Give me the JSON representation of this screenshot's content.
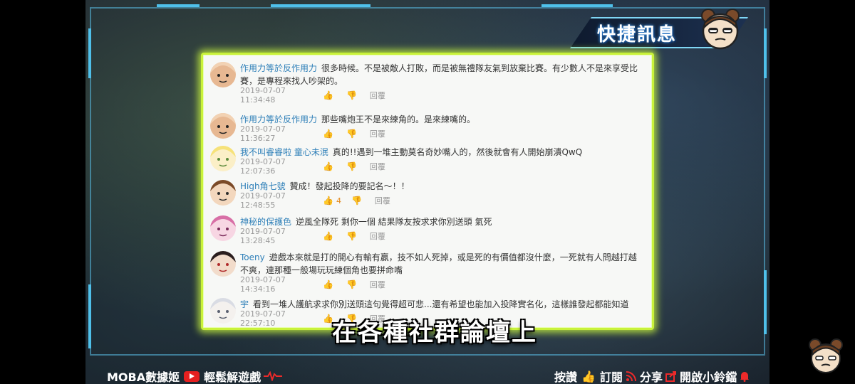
{
  "header": {
    "title": "快捷訊息"
  },
  "comments": [
    {
      "user": "作用力等於反作用力",
      "text": "很多時候。不是被敵人打敗，而是被無禮隊友氣到放棄比賽。有少數人不是來享受比賽，是專程來找人吵架的。",
      "timestamp": "2019-07-07 11:34:48",
      "likes": "",
      "reply_label": "回覆",
      "avatar": "bald-man-avatar"
    },
    {
      "user": "作用力等於反作用力",
      "text": "那些嘴炮王不是來練角的。是來練嘴的。",
      "timestamp": "2019-07-07 11:36:27",
      "likes": "",
      "reply_label": "回覆",
      "avatar": "bald-man-avatar"
    },
    {
      "user": "我不叫睿睿啦  童心未泯",
      "text": "真的!!遇到一堆主動莫名奇妙嘴人的，然後就會有人開始崩潰QwQ",
      "timestamp": "2019-07-07 12:07:36",
      "likes": "",
      "reply_label": "回覆",
      "avatar": "blonde-anime-avatar"
    },
    {
      "user": "High角七號",
      "text": "贊成！發起投降的要記名～！！",
      "timestamp": "2019-07-07 12:48:55",
      "likes": "4",
      "reply_label": "回覆",
      "avatar": "brown-hair-anime-avatar"
    },
    {
      "user": "神秘的保護色",
      "text": "逆風全隊死 剩你一個 結果隊友按求求你別送頭 氣死",
      "timestamp": "2019-07-07 13:28:45",
      "likes": "",
      "reply_label": "回覆",
      "avatar": "pink-hair-anime-avatar"
    },
    {
      "user": "Toeny",
      "text": "遊戲本來就是打的開心有輸有贏，技不如人死掉，或是死的有價值都沒什麼，一死就有人問越打越不爽，連那種一般場玩玩練個角也要拼命嘴",
      "timestamp": "2019-07-07 14:34:16",
      "likes": "",
      "reply_label": "回覆",
      "avatar": "dark-hair-anime-avatar"
    },
    {
      "user": "宇",
      "text": "看到一堆人護航求求你別送頭這句覺得超可悲...還有希望也能加入投降實名化，這樣誰發起都能知道",
      "timestamp": "2019-07-07 22:57:10",
      "likes": "",
      "reply_label": "回覆",
      "avatar": "white-hair-anime-avatar"
    }
  ],
  "subtitle": "在各種社群論壇上",
  "footer": {
    "channel_name": "MOBA數據姬",
    "channel_slogan": "輕鬆解遊戲",
    "like_label": "按讚",
    "subscribe_label": "訂閱",
    "share_label": "分享",
    "bell_label": "開啟小鈴鐺"
  },
  "colors": {
    "panel_border": "#c9f23a",
    "username": "#2e7fb8",
    "active_like": "#e38a1e",
    "frame": "#4fc0ea"
  }
}
